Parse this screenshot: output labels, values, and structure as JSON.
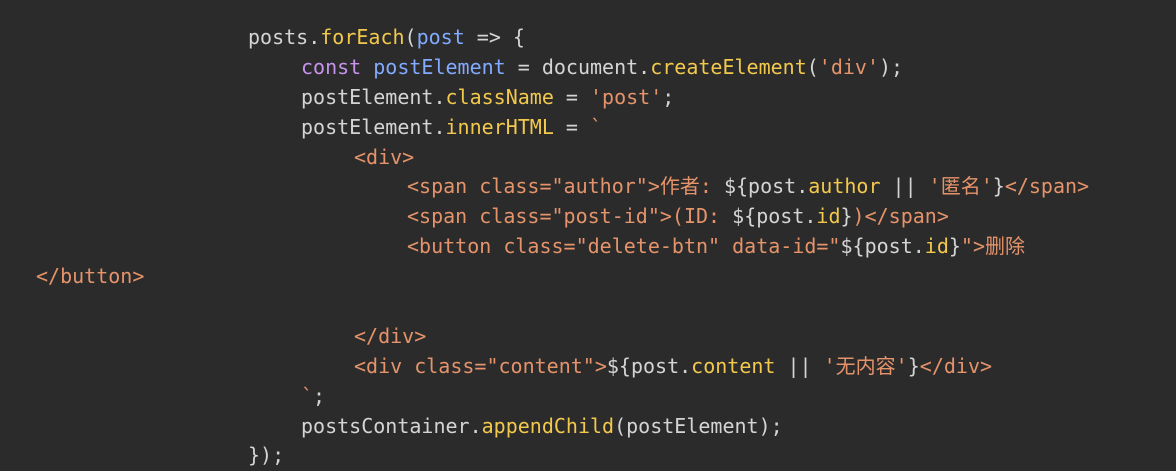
{
  "code_lines": [
    {
      "indent": 248,
      "tokens": [
        {
          "text": "posts.",
          "kind": "plain"
        },
        {
          "text": "forEach",
          "kind": "fn"
        },
        {
          "text": "(",
          "kind": "plain"
        },
        {
          "text": "post",
          "kind": "def"
        },
        {
          "text": " => {",
          "kind": "plain"
        }
      ]
    },
    {
      "indent": 301,
      "tokens": [
        {
          "text": "const ",
          "kind": "kw"
        },
        {
          "text": "postElement",
          "kind": "def"
        },
        {
          "text": " = document.",
          "kind": "plain"
        },
        {
          "text": "createElement",
          "kind": "fn"
        },
        {
          "text": "(",
          "kind": "plain"
        },
        {
          "text": "'div'",
          "kind": "str"
        },
        {
          "text": ");",
          "kind": "plain"
        }
      ]
    },
    {
      "indent": 301,
      "tokens": [
        {
          "text": "postElement.",
          "kind": "plain"
        },
        {
          "text": "className",
          "kind": "fn"
        },
        {
          "text": " = ",
          "kind": "plain"
        },
        {
          "text": "'post'",
          "kind": "str"
        },
        {
          "text": ";",
          "kind": "plain"
        }
      ]
    },
    {
      "indent": 301,
      "tokens": [
        {
          "text": "postElement.",
          "kind": "plain"
        },
        {
          "text": "innerHTML",
          "kind": "fn"
        },
        {
          "text": " = ",
          "kind": "plain"
        },
        {
          "text": "`",
          "kind": "str"
        }
      ]
    },
    {
      "indent": 354,
      "tokens": [
        {
          "text": "<div>",
          "kind": "str"
        }
      ]
    },
    {
      "indent": 407,
      "tokens": [
        {
          "text": "<span class=\"author\">作者: ",
          "kind": "str"
        },
        {
          "text": "${post.",
          "kind": "plain"
        },
        {
          "text": "author",
          "kind": "fn"
        },
        {
          "text": " || ",
          "kind": "plain"
        },
        {
          "text": "'匿名'",
          "kind": "str"
        },
        {
          "text": "}",
          "kind": "plain"
        },
        {
          "text": "</span>",
          "kind": "str"
        }
      ]
    },
    {
      "indent": 407,
      "tokens": [
        {
          "text": "<span class=\"post-id\">(ID: ",
          "kind": "str"
        },
        {
          "text": "${post.",
          "kind": "plain"
        },
        {
          "text": "id",
          "kind": "fn"
        },
        {
          "text": "}",
          "kind": "plain"
        },
        {
          "text": ")</span>",
          "kind": "str"
        }
      ]
    },
    {
      "indent": 407,
      "tokens": [
        {
          "text": "<button class=\"delete-btn\" data-id=\"",
          "kind": "str"
        },
        {
          "text": "${post.",
          "kind": "plain"
        },
        {
          "text": "id",
          "kind": "fn"
        },
        {
          "text": "}",
          "kind": "plain"
        },
        {
          "text": "\">删除",
          "kind": "str"
        }
      ]
    },
    {
      "indent": 36,
      "tokens": [
        {
          "text": "</button>",
          "kind": "str"
        }
      ]
    },
    {
      "indent": 0,
      "tokens": []
    },
    {
      "indent": 354,
      "tokens": [
        {
          "text": "</div>",
          "kind": "str"
        }
      ]
    },
    {
      "indent": 354,
      "tokens": [
        {
          "text": "<div class=\"content\">",
          "kind": "str"
        },
        {
          "text": "${post.",
          "kind": "plain"
        },
        {
          "text": "content",
          "kind": "fn"
        },
        {
          "text": " || ",
          "kind": "plain"
        },
        {
          "text": "'无内容'",
          "kind": "str"
        },
        {
          "text": "}",
          "kind": "plain"
        },
        {
          "text": "</div>",
          "kind": "str"
        }
      ]
    },
    {
      "indent": 301,
      "tokens": [
        {
          "text": "`",
          "kind": "str"
        },
        {
          "text": ";",
          "kind": "plain"
        }
      ]
    },
    {
      "indent": 301,
      "tokens": [
        {
          "text": "postsContainer.",
          "kind": "plain"
        },
        {
          "text": "appendChild",
          "kind": "fn"
        },
        {
          "text": "(postElement);",
          "kind": "plain"
        }
      ]
    },
    {
      "indent": 248,
      "tokens": [
        {
          "text": "});",
          "kind": "plain"
        }
      ]
    }
  ],
  "colors": {
    "background": "#2b2b2b",
    "plain": "#d4d4d4",
    "keyword": "#c792ea",
    "definition": "#82aaff",
    "function": "#f2c94c",
    "string": "#e5936a"
  }
}
